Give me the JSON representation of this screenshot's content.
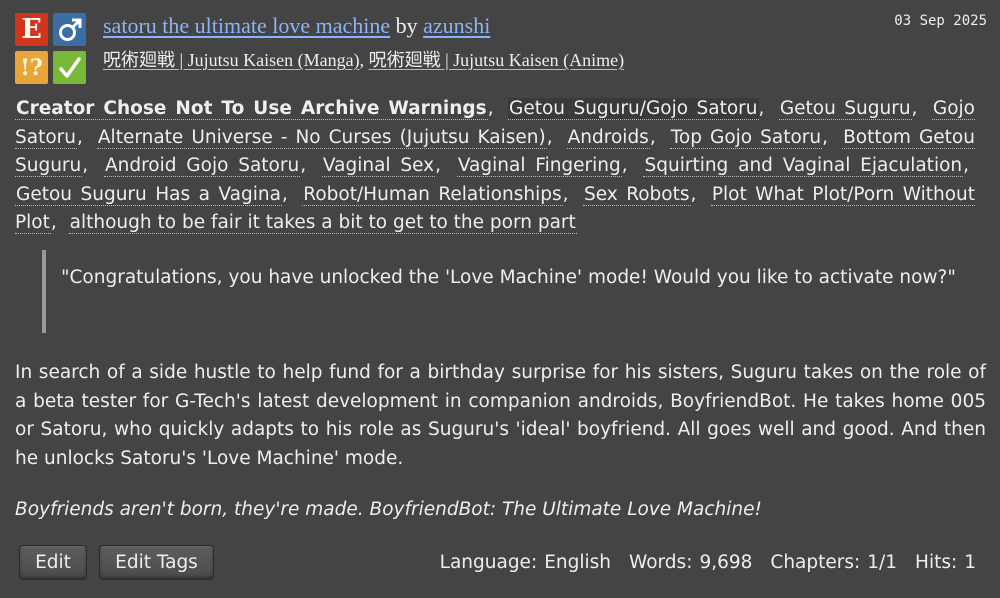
{
  "badges": {
    "rating": "E",
    "category": "♂",
    "warning": "!?",
    "complete": "✓",
    "colors": {
      "rating": "#d1361c",
      "category": "#3a6ea5",
      "warning": "#e8a63a",
      "complete": "#7ab838"
    }
  },
  "work": {
    "title": "satoru the ultimate love machine",
    "by": "by",
    "author": "azunshi",
    "date": "03 Sep 2025",
    "fandoms": [
      "呪術廻戦 | Jujutsu Kaisen (Manga)",
      "呪術廻戦 | Jujutsu Kaisen (Anime)"
    ]
  },
  "tags": [
    "Creator Chose Not To Use Archive Warnings",
    "Getou Suguru/Gojo Satoru",
    "Getou Suguru",
    "Gojo Satoru",
    "Alternate Universe - No Curses (Jujutsu Kaisen)",
    "Androids",
    "Top Gojo Satoru",
    "Bottom Getou Suguru",
    "Android Gojo Satoru",
    "Vaginal Sex",
    "Vaginal Fingering",
    "Squirting and Vaginal Ejaculation",
    "Getou Suguru Has a Vagina",
    "Robot/Human Relationships",
    "Sex Robots",
    "Plot What Plot/Porn Without Plot",
    "although to be fair it takes a bit to get to the porn part"
  ],
  "quote": "\"Congratulations, you have unlocked the 'Love Machine' mode! Would you like to activate now?\"",
  "summary": "In search of a side hustle to help fund for a birthday surprise for his sisters, Suguru takes on the role of a beta tester for G-Tech's latest development in companion androids, BoyfriendBot. He takes home 005 or Satoru, who quickly adapts to his role as Suguru's 'ideal' boyfriend. All goes well and good. And then he unlocks Satoru's 'Love Machine' mode.",
  "tagline": "Boyfriends aren't born, they're made. BoyfriendBot: The Ultimate Love Machine!",
  "actions": {
    "edit": "Edit",
    "edit_tags": "Edit Tags"
  },
  "stats": {
    "language_label": "Language:",
    "language": "English",
    "words_label": "Words:",
    "words": "9,698",
    "chapters_label": "Chapters:",
    "chapters": "1/1",
    "hits_label": "Hits:",
    "hits": "1"
  }
}
